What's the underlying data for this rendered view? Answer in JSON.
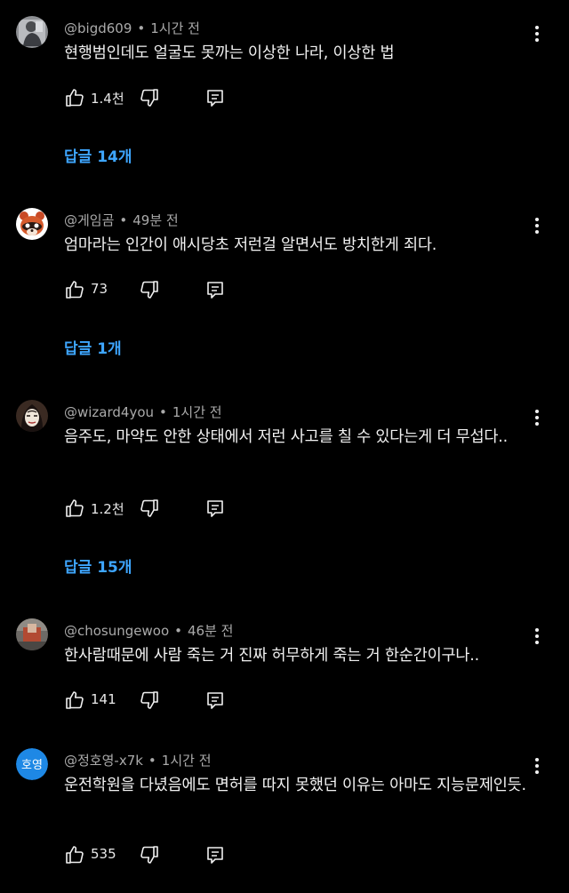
{
  "colors": {
    "background": "#000000",
    "text": "#f1f1f1",
    "meta": "#aaaaaa",
    "link": "#3ea6ff"
  },
  "comments": [
    {
      "author": "@bigd609",
      "time": "1시간 전",
      "text": "현행범인데도 얼굴도 못까는 이상한 나라, 이상한 법",
      "likes": "1.4천",
      "replies_label": "답글 14개",
      "avatar": "gray-figure-avatar"
    },
    {
      "author": "@게임곰",
      "time": "49분 전",
      "text": "엄마라는 인간이 애시당초 저런걸 알면서도 방치한게 죄다.",
      "likes": "73",
      "replies_label": "답글 1개",
      "avatar": "raccoon-avatar"
    },
    {
      "author": "@wizard4you",
      "time": "1시간 전",
      "text": "음주도, 마약도 안한 상태에서 저런 사고를 칠 수 있다는게 더 무섭다..",
      "likes": "1.2천",
      "replies_label": "답글 15개",
      "avatar": "mask-avatar"
    },
    {
      "author": "@chosungewoo",
      "time": "46분 전",
      "text": "한사람때문에 사람 죽는 거 진짜 허무하게 죽는 거 한순간이구나..",
      "likes": "141",
      "avatar": "photo-avatar"
    },
    {
      "author": "@정호영-x7k",
      "time": "1시간 전",
      "text": "운전학원을 다녔음에도 면허를 따지 못했던 이유는 아마도 지능문제인듯.",
      "likes": "535",
      "avatar": "initials-avatar",
      "avatar_initials": "호영",
      "avatar_color": "#1e88e5"
    }
  ]
}
